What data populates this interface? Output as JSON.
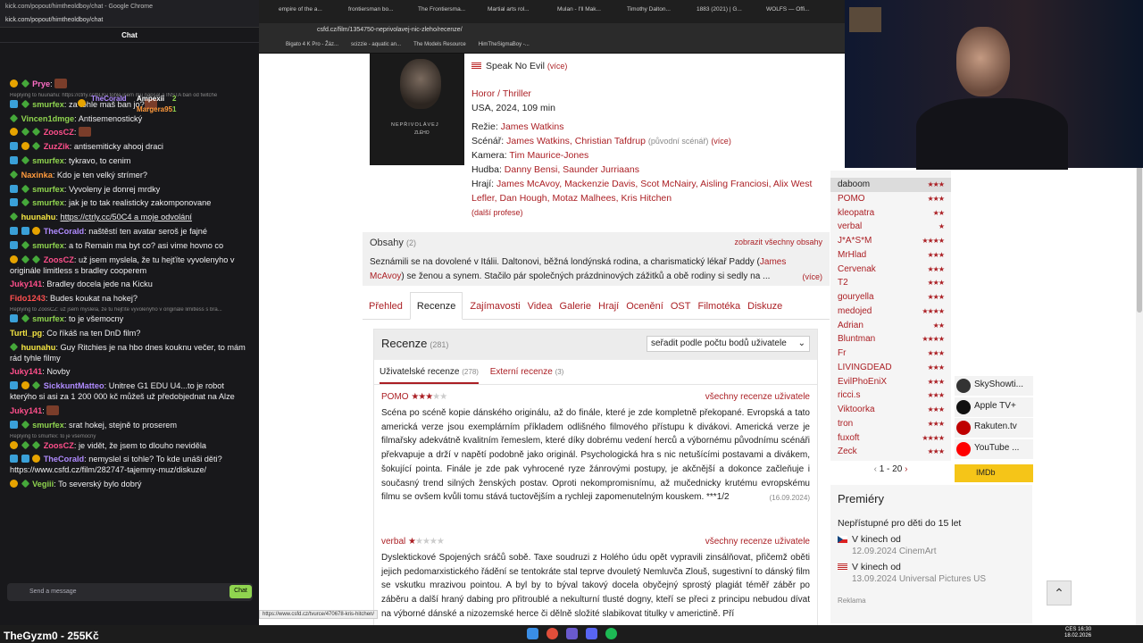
{
  "twitch": {
    "window_title": "kick.com/popout/himtheoldboy/chat - Google Chrome",
    "url": "kick.com/popout/himtheoldboy/chat",
    "chat_heading": "Chat",
    "leaderboard": {
      "first": "TheCoraId",
      "first_count": "3",
      "second": "Ampexii",
      "second_count": "2",
      "third": "Margera95",
      "third_count": "1"
    },
    "messages": [
      {
        "user": "Prye",
        "color": "#ff6ec7",
        "text": "",
        "badges": "y,g",
        "emote": true
      },
      {
        "reply": "Replying to huunahu: https://ctrly.cc/bLKv tohle jsem mu napsal a INSTA ban od twitche"
      },
      {
        "user": "smurfex",
        "color": "#8fd44f",
        "text": "za tohle maš ban jo?",
        "badges": "b,g",
        "emote": true
      },
      {
        "user": "Vincen1dmge",
        "color": "#8fd44f",
        "text": "Antisemenostický",
        "badges": "g"
      },
      {
        "user": "ZoosCZ",
        "color": "#ff4f8b",
        "text": "",
        "badges": "y,g,g",
        "emote": true
      },
      {
        "user": "ZuzZik",
        "color": "#ff4f8b",
        "text": "antisemiticky ahooj draci",
        "badges": "b,y,g"
      },
      {
        "user": "smurfex",
        "color": "#8fd44f",
        "text": "tykravo, to cenim",
        "badges": "b,g"
      },
      {
        "user": "Naxinka",
        "color": "#ff9a3c",
        "text": "Kdo je ten velký strímer?",
        "badges": "g"
      },
      {
        "user": "smurfex",
        "color": "#8fd44f",
        "text": "Vyvoleny je donrej mrdky",
        "badges": "b,g"
      },
      {
        "user": "smurfex",
        "color": "#8fd44f",
        "text": "jak je to tak realisticky zakomponovane",
        "badges": "b,g"
      },
      {
        "user": "huunahu",
        "color": "#f5e642",
        "text": "https://ctrly.cc/50C4 a moje odvolání",
        "badges": "g",
        "link": true
      },
      {
        "user": "TheCoraId",
        "color": "#b08bff",
        "text": "naštěstí ten avatar seroš je fajné",
        "badges": "b,b,y"
      },
      {
        "user": "smurfex",
        "color": "#8fd44f",
        "text": "a to Remain ma byt co? asi vime hovno co",
        "badges": "b,g"
      },
      {
        "user": "ZoosCZ",
        "color": "#ff4f8b",
        "text": "už jsem myslela, že tu hejťíte vyvolenyho v originále limitless s bradley cooperem",
        "badges": "y,g,g",
        "wrap": true
      },
      {
        "user": "Juky141",
        "color": "#ff4f8b",
        "text": "Bradley docela jede na Kicku",
        "badges": ""
      },
      {
        "user": "Fido1243",
        "color": "#ff4f4f",
        "text": "Budes koukat na hokej?",
        "badges": ""
      },
      {
        "reply": "Replying to ZoosCZ: už jsem myslela, že tu hejťíte vyvolenyho v originále limitless s bra..."
      },
      {
        "user": "smurfex",
        "color": "#8fd44f",
        "text": "to je všemocny",
        "badges": "b,g"
      },
      {
        "user": "Turtl_pg",
        "color": "#f5e642",
        "text": "Co říkáš na ten DnD film?",
        "badges": ""
      },
      {
        "user": "huunahu",
        "color": "#f5e642",
        "text": "Guy Ritchies je na hbo dnes kouknu večer, to mám rád tyhle filmy",
        "badges": "g",
        "wrap": true
      },
      {
        "user": "Juky141",
        "color": "#ff4f8b",
        "text": "Novby",
        "badges": ""
      },
      {
        "user": "SickkuntMatteo",
        "color": "#b08bff",
        "text": "Unitree G1 EDU U4...to je robot kterýho si asi za 1 200 000 kč můžeš už předobjednat na Alze",
        "badges": "b,y,g",
        "wrap": true
      },
      {
        "user": "Juky141",
        "color": "#ff4f8b",
        "text": "",
        "badges": "",
        "emote": true
      },
      {
        "user": "smurfex",
        "color": "#8fd44f",
        "text": "srat hokej, stejně to proserem",
        "badges": "b,g"
      },
      {
        "reply": "Replying to smurfex: to je všemocny"
      },
      {
        "user": "ZoosCZ",
        "color": "#ff4f8b",
        "text": "je vidět, že jsem to dlouho neviděla",
        "badges": "y,g,g"
      },
      {
        "user": "TheCoraId",
        "color": "#b08bff",
        "text": "nemyslel si tohle? To kde unáši děti? https://www.csfd.cz/film/282747-tajemny-muz/diskuze/",
        "badges": "b,b,y",
        "wrap": true
      },
      {
        "user": "Vegiii",
        "color": "#8fd44f",
        "text": "To severský bylo dobrý",
        "badges": "y,g"
      }
    ],
    "input_placeholder": "Send a message",
    "chat_button": "Chat"
  },
  "browser": {
    "tabs": [
      "empire of the a...",
      "frontiersman bo...",
      "The Frontiersma...",
      "Martial arts rol...",
      "Mulan - I'll Mak...",
      "Timothy Dalton...",
      "1883 (2021) | G...",
      "WOLFS — Offi..."
    ],
    "url": "csfd.cz/film/1354750-neprivolavej-nic-zleho/recenze/",
    "bookmarks": [
      "Bigato 4 K Pro - Žáz...",
      "scizzie - aquatic an...",
      "The Models Resource",
      "HimTheSigmaBoy -..."
    ],
    "status_link": "https://www.csfd.cz/tvurce/470678-kris-hitchen/"
  },
  "film": {
    "poster_title": "NEPŘIVOLÁVEJ",
    "poster_sub": "ZLÉHO",
    "orig_title": "Speak No Evil",
    "more": "(více)",
    "genre": "Horor / Thriller",
    "origin": "USA, 2024, 109 min",
    "director_label": "Režie:",
    "director": "James Watkins",
    "writer_label": "Scénář:",
    "writers": "James Watkins, Christian Tafdrup",
    "writer_note": "(původní scénář)",
    "camera_label": "Kamera:",
    "camera": "Tim Maurice-Jones",
    "music_label": "Hudba:",
    "music": "Danny Bensi, Saunder Jurriaans",
    "cast_label": "Hrají:",
    "cast": "James McAvoy, Mackenzie Davis, Scot McNairy, Aisling Franciosi, Alix West Lefler, Dan Hough, Motaz Malhees, Kris Hitchen",
    "more_professions": "(další profese)",
    "plot_heading": "Obsahy",
    "plot_count": "(2)",
    "plot_all": "zobrazit všechny obsahy",
    "plot_l1": "Seznámili se na dovolené v Itálii. Daltonovi, běžná londýnská rodina, a charismatický lékař Paddy (",
    "plot_link1": "James",
    "plot_link2": "McAvoy",
    "plot_l2": ") se ženou a synem. Stačilo pár společných prázdninových zážitků a obě rodiny si sedly na ...",
    "subnav": [
      "Přehled",
      "Recenze",
      "Zajímavosti",
      "Videa",
      "Galerie",
      "Hrají",
      "Ocenění",
      "OST",
      "Filmotéka",
      "Diskuze"
    ],
    "reviews_heading": "Recenze",
    "reviews_count": "(281)",
    "sort_label": "seřadit podle počtu bodů uživatele",
    "tab_user": "Uživatelské recenze",
    "tab_user_count": "(278)",
    "tab_ext": "Externí recenze",
    "tab_ext_count": "(3)",
    "all_user_reviews": "všechny recenze uživatele",
    "reviews": [
      {
        "user": "POMO",
        "stars": 3,
        "date": "(16.09.2024)",
        "text": "Scéna po scéně kopie dánského originálu, až do finále, které je zde kompletně překopané. Evropská a tato americká verze jsou exemplárním příkladem odlišného filmového přístupu k divákovi. Americká verze je filmařsky adekvátně kvalitním řemeslem, které díky dobrému vedení herců a výbornému původnímu scénáři překvapuje a drží v napětí podobně jako originál. Psychologická hra s nic netušícími postavami a divákem, šokující pointa. Finále je zde pak vyhrocené ryze žánrovými postupy, je akčnější a dokonce začleňuje i současný trend silných ženských postav. Oproti nekompromisnímu, až mučednicky krutému evropskému filmu se ovšem kvůli tomu stává tuctovějším a rychleji zapomenutelným kouskem. ***1/2"
      },
      {
        "user": "verbal",
        "stars": 1,
        "date": "",
        "text": "Dyslektickové Spojených sráčů sobě. Taxe soudruzi z Holého údu opět vypravili zinsálňovat, přičemž oběti jejich pedomarxistického řádění se tentokráte stal teprve dvouletý Nemluvča Zlouš, sugestivní to dánský film se vskutku mrazivou pointou. A byl by to býval takový docela obyčejný sprostý plagiát téměř záběr po záběru a další hraný dabing pro přitroublé a nekulturní tlusté dogny, kteří se přeci z principu nebudou dívat na výborné dánské a nizozemské herce či dělně složité slabikovat titulky v americtině. Pří"
      }
    ]
  },
  "sidebar": {
    "users": [
      {
        "name": "daboom",
        "stars": 3
      },
      {
        "name": "POMO",
        "stars": 3
      },
      {
        "name": "kleopatra",
        "stars": 2
      },
      {
        "name": "verbal",
        "stars": 1
      },
      {
        "name": "J*A*S*M",
        "stars": 4
      },
      {
        "name": "MrHlad",
        "stars": 3
      },
      {
        "name": "Cervenak",
        "stars": 3
      },
      {
        "name": "T2",
        "stars": 3
      },
      {
        "name": "gouryella",
        "stars": 3
      },
      {
        "name": "medojed",
        "stars": 4
      },
      {
        "name": "Adrian",
        "stars": 2
      },
      {
        "name": "Bluntman",
        "stars": 4
      },
      {
        "name": "Fr",
        "stars": 3
      },
      {
        "name": "LIVINGDEAD",
        "stars": 3
      },
      {
        "name": "EvilPhoEniX",
        "stars": 3
      },
      {
        "name": "ricci.s",
        "stars": 3
      },
      {
        "name": "Viktoorka",
        "stars": 3
      },
      {
        "name": "tron",
        "stars": 3
      },
      {
        "name": "fuxoft",
        "stars": 4
      },
      {
        "name": "Zeck",
        "stars": 3
      }
    ],
    "pagination": "1 - 20",
    "vod": [
      {
        "name": "SkyShowti...",
        "color": "#333"
      },
      {
        "name": "Apple TV+",
        "color": "#111"
      },
      {
        "name": "Rakuten.tv",
        "color": "#bf0000"
      },
      {
        "name": "YouTube ...",
        "color": "#ff0000"
      }
    ],
    "imdb": "IMDb",
    "premiere_heading": "Premiéry",
    "premiere_age": "Nepřístupné pro děti do 15 let",
    "premieres": [
      {
        "label": "V kinech od",
        "date": "12.09.2024 CinemArt",
        "flag": "cz"
      },
      {
        "label": "V kinech od",
        "date": "13.09.2024 Universal Pictures US",
        "flag": "us"
      }
    ],
    "ad_label": "Reklama"
  },
  "taskbar": {
    "overlay": "TheGyzm0 - 255Kč",
    "lang": "CES",
    "time": "16:30",
    "date": "18.02.2026"
  },
  "colors": {
    "accent": "#ab1f24",
    "kick_green": "#53fc18"
  }
}
